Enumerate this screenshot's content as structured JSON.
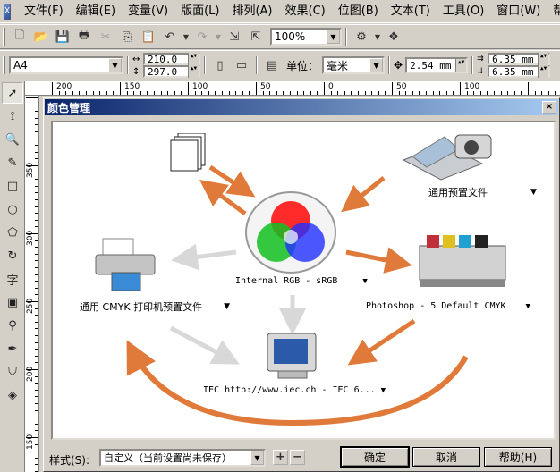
{
  "menubar": {
    "items": [
      "文件(F)",
      "编辑(E)",
      "变量(V)",
      "版面(L)",
      "排列(A)",
      "效果(C)",
      "位图(B)",
      "文本(T)",
      "工具(O)",
      "窗口(W)",
      "帮助"
    ]
  },
  "toolbar": {
    "zoom": "100%"
  },
  "property_bar": {
    "paper": "A4",
    "width": "210.0",
    "height": "297.0",
    "units_label": "单位：",
    "units": "毫米",
    "nudge": "2.54 mm",
    "dup_x": "6.35 mm",
    "dup_y": "6.35 mm"
  },
  "ruler": {
    "h_labels": [
      "200",
      "150",
      "100",
      "50",
      "0",
      "50",
      "100"
    ],
    "v_labels": [
      "350",
      "300",
      "250",
      "200",
      "150"
    ]
  },
  "dialog": {
    "title": "颜色管理",
    "close": "×",
    "scanner_profile": "通用预置文件",
    "monitor_rgb": "Internal RGB - sRGB",
    "printer_profile": "通用 CMYK 打印机预置文件",
    "press_profile": "Photoshop - 5 Default CMYK",
    "display_profile": "IEC http://www.iec.ch - IEC 6...",
    "style_label": "样式(S):",
    "style_value": "自定义（当前设置尚未保存）",
    "ok": "确定",
    "cancel": "取消",
    "help": "帮助(H)"
  },
  "colors": {
    "arrow_orange": "#e07a3a",
    "arrow_gray": "#d8d8d8",
    "title_start": "#0a246a",
    "title_end": "#a6caf0"
  }
}
